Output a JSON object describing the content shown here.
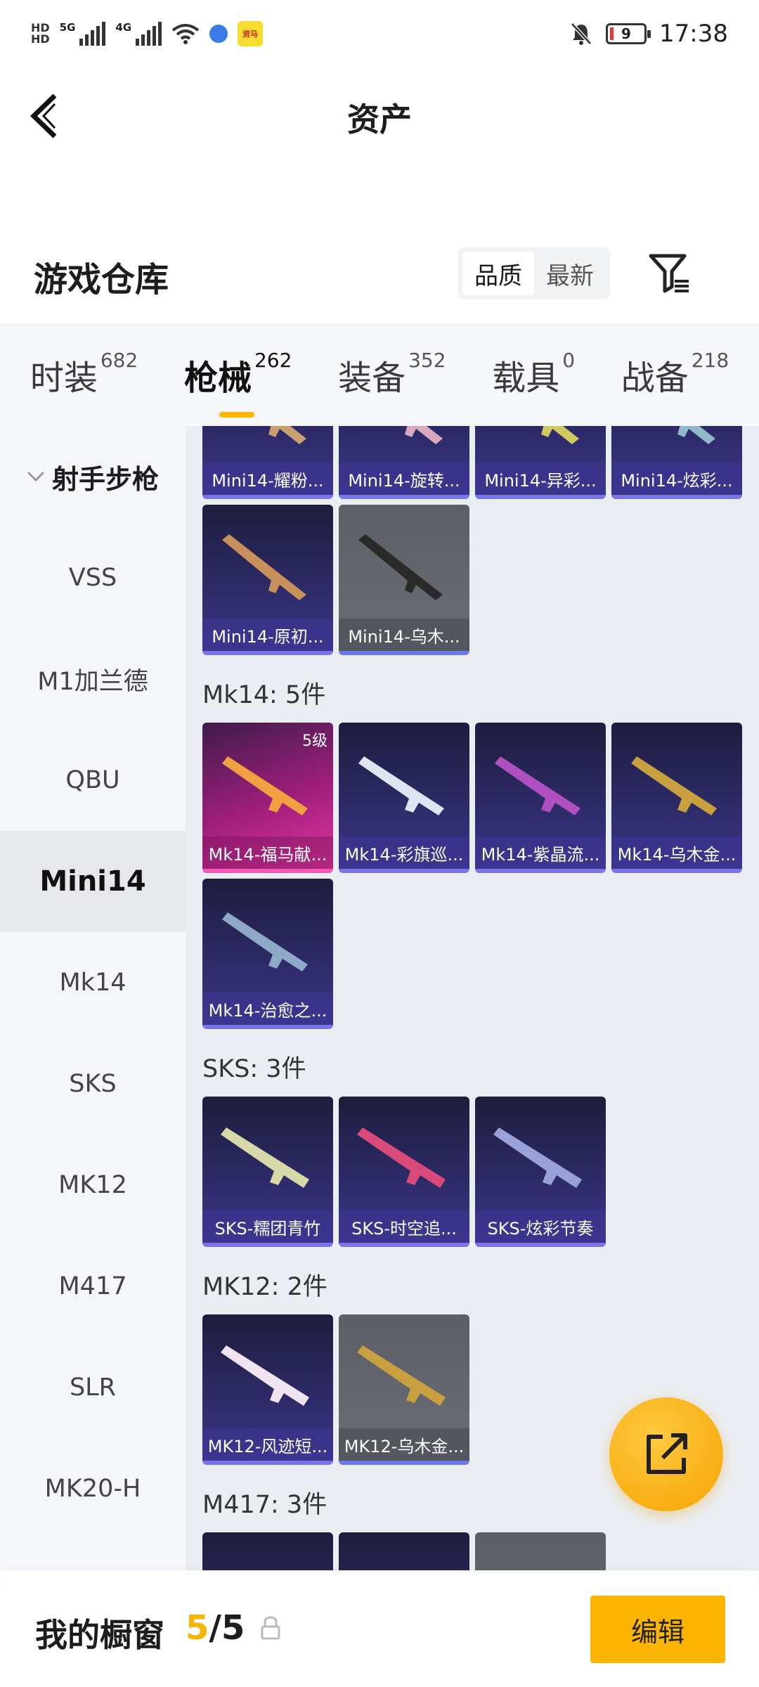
{
  "status_bar": {
    "left_tiny_top": "HD",
    "left_tiny_bottom": "HD",
    "network1": "5G",
    "network2": "4G",
    "app_badge": "资马",
    "battery": "9",
    "time": "17:38"
  },
  "header": {
    "title": "资产"
  },
  "warehouse": {
    "title": "游戏仓库",
    "sort_options": [
      "品质",
      "最新"
    ],
    "sort_selected": "品质"
  },
  "tabs": [
    {
      "label": "时装",
      "count": "682"
    },
    {
      "label": "枪械",
      "count": "262"
    },
    {
      "label": "装备",
      "count": "352"
    },
    {
      "label": "载具",
      "count": "0"
    },
    {
      "label": "战备",
      "count": "218"
    }
  ],
  "sidebar": {
    "category": "射手步枪",
    "items": [
      "VSS",
      "M1加兰德",
      "QBU",
      "Mini14",
      "Mk14",
      "SKS",
      "MK12",
      "M417",
      "SLR",
      "MK20-H"
    ],
    "active": "Mini14"
  },
  "content": {
    "mini14_row1": [
      "Mini14-耀粉...",
      "Mini14-旋转...",
      "Mini14-异彩...",
      "Mini14-炫彩..."
    ],
    "mini14_row2": [
      "Mini14-原初...",
      "Mini14-乌木..."
    ],
    "mk14_label": "Mk14: 5件",
    "mk14_items": [
      "Mk14-福马献...",
      "Mk14-彩旗巡...",
      "Mk14-紫晶流...",
      "Mk14-乌木金...",
      "Mk14-治愈之..."
    ],
    "mk14_level": "5级",
    "sks_label": "SKS: 3件",
    "sks_items": [
      "SKS-糯团青竹",
      "SKS-时空追...",
      "SKS-炫彩节奏"
    ],
    "mk12_label": "MK12: 2件",
    "mk12_items": [
      "MK12-风迹短...",
      "MK12-乌木金..."
    ],
    "m417_label": "M417: 3件"
  },
  "bottom": {
    "showcase_label": "我的橱窗",
    "showcase_current": "5",
    "showcase_total": "/5",
    "edit_label": "编辑"
  },
  "colors": {
    "accent": "#FBB400",
    "card_purple": "#2D2A66",
    "card_grey": "#6C6E76",
    "card_pink": "#E0389F"
  }
}
